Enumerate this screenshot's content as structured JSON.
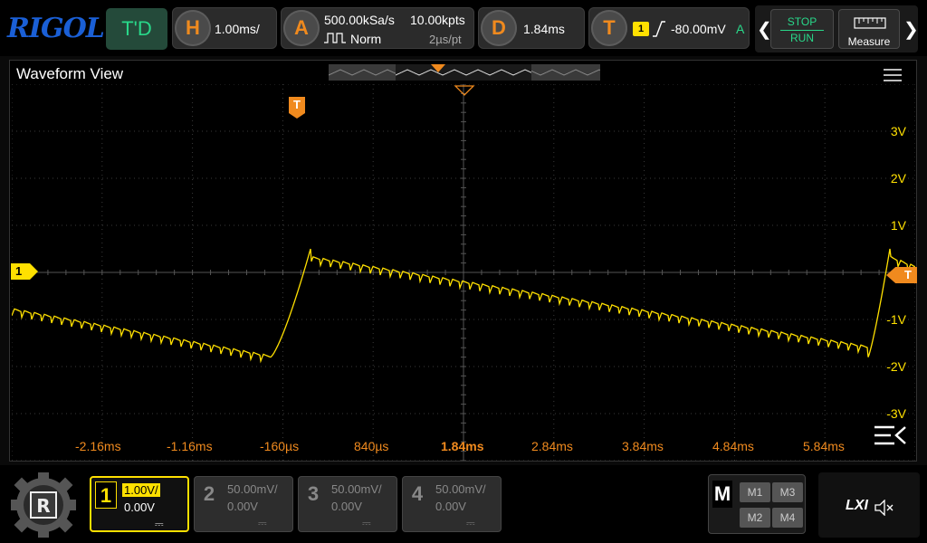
{
  "brand": "RIGOL",
  "trigger_status": "T'D",
  "horizontal": {
    "key": "H",
    "timebase": "1.00ms/"
  },
  "acquire": {
    "key": "A",
    "sample_rate": "500.00kSa/s",
    "mode": "Norm",
    "memory_depth": "10.00kpts",
    "resolution": "2µs/pt"
  },
  "delay": {
    "key": "D",
    "value": "1.84ms"
  },
  "trigger": {
    "key": "T",
    "source": "1",
    "level": "-80.00mV",
    "coupling": "A"
  },
  "run_control": {
    "stop_label": "STOP",
    "run_label": "RUN"
  },
  "measure": {
    "label": "Measure"
  },
  "waveform_view": {
    "title": "Waveform View"
  },
  "markers": {
    "channel": "1",
    "trigger": "T",
    "trigger_level": "T"
  },
  "volt_labels": [
    "3V",
    "2V",
    "1V",
    "-1V",
    "-2V",
    "-3V"
  ],
  "time_labels": [
    "-2.16ms",
    "-1.16ms",
    "-160µs",
    "840µs",
    "1.84ms",
    "2.84ms",
    "3.84ms",
    "4.84ms",
    "5.84ms"
  ],
  "channels": [
    {
      "num": "1",
      "scale": "1.00V/",
      "offset": "0.00V",
      "active": true
    },
    {
      "num": "2",
      "scale": "50.00mV/",
      "offset": "0.00V",
      "active": false
    },
    {
      "num": "3",
      "scale": "50.00mV/",
      "offset": "0.00V",
      "active": false
    },
    {
      "num": "4",
      "scale": "50.00mV/",
      "offset": "0.00V",
      "active": false
    }
  ],
  "math": {
    "key": "M",
    "buttons": [
      "M1",
      "M3",
      "M2",
      "M4"
    ]
  },
  "lxi": {
    "label": "LXI"
  },
  "colors": {
    "ch1": "#ffe000",
    "trigger": "#f08a1e",
    "run": "#29d88a",
    "brand": "#1a5fd6"
  }
}
